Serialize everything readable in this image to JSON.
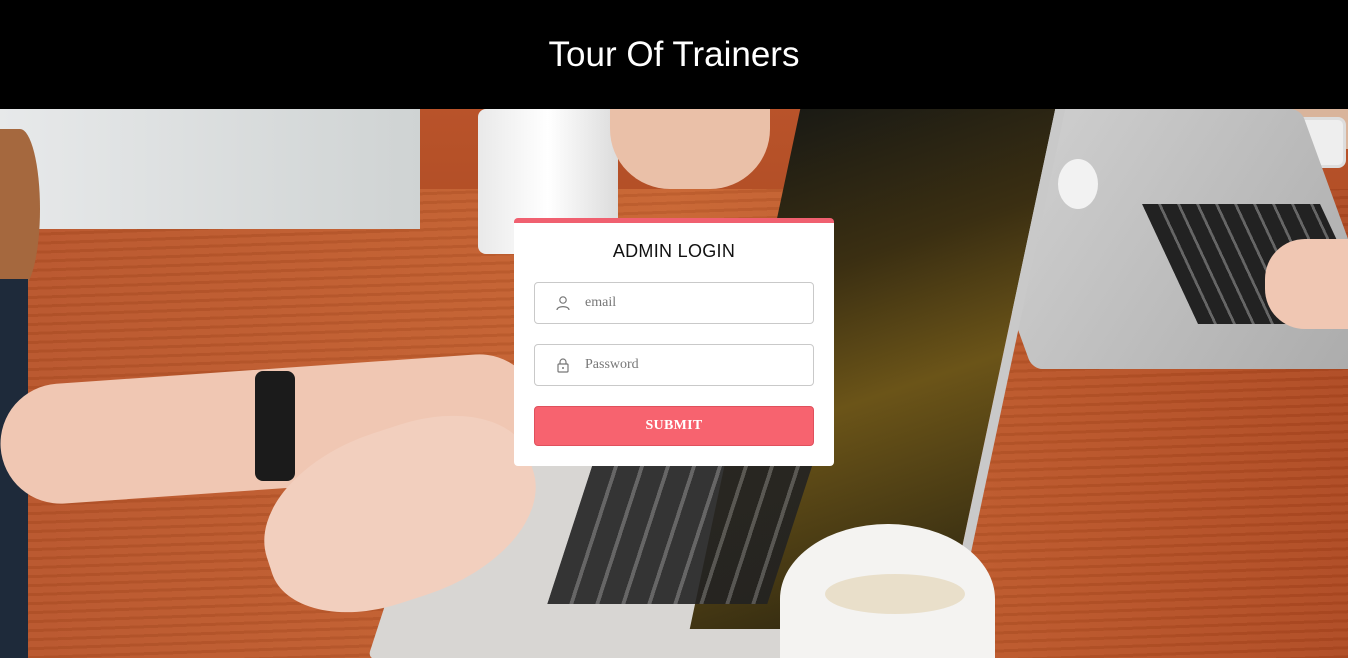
{
  "header": {
    "title": "Tour Of Trainers"
  },
  "login": {
    "title": "ADMIN LOGIN",
    "email": {
      "placeholder": "email",
      "value": "",
      "icon": "user-icon"
    },
    "password": {
      "placeholder": "Password",
      "value": "",
      "icon": "lock-icon"
    },
    "submit_label": "SUBMIT"
  },
  "colors": {
    "header_bg": "#000000",
    "accent": "#f7636f",
    "card_bg": "#ffffff"
  },
  "background": {
    "icon": "office-laptops-photo"
  }
}
